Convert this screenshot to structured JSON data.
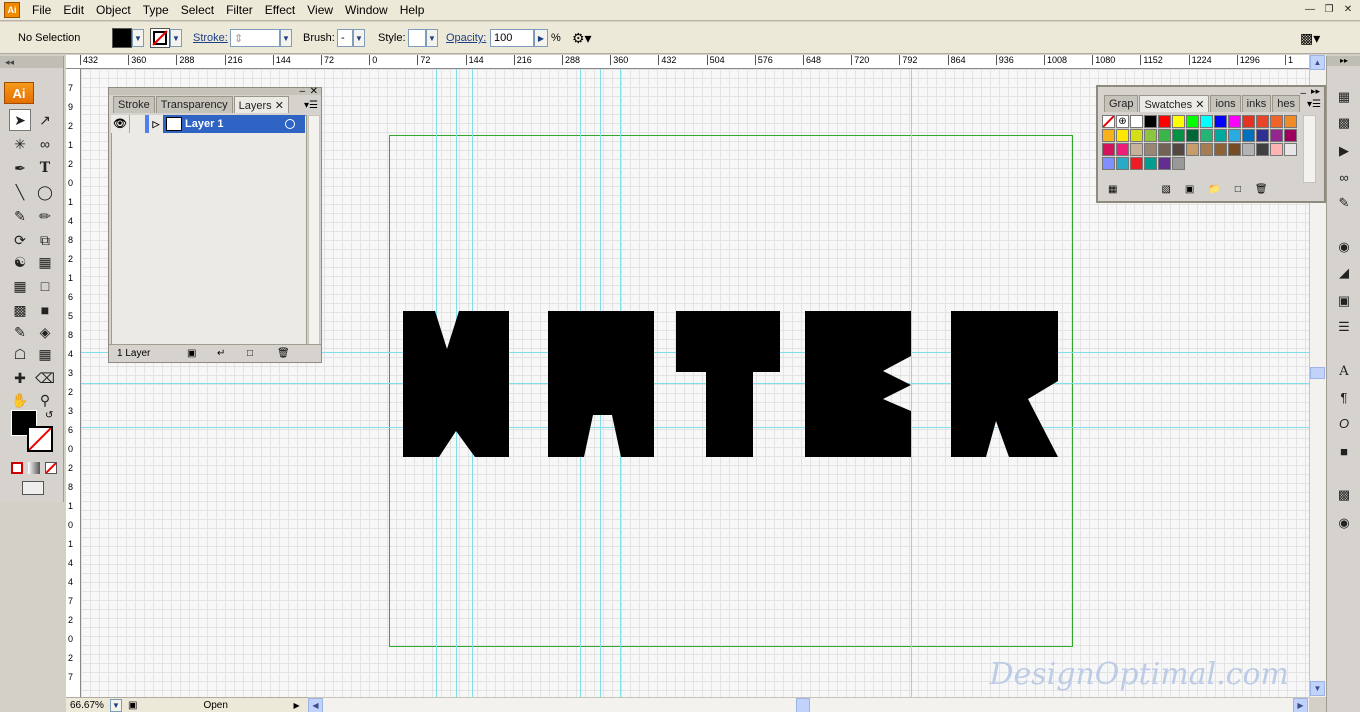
{
  "menubar": {
    "items": [
      "File",
      "Edit",
      "Object",
      "Type",
      "Select",
      "Filter",
      "Effect",
      "View",
      "Window",
      "Help"
    ]
  },
  "controlbar": {
    "selection": "No Selection",
    "stroke_label": "Stroke:",
    "brush_label": "Brush:",
    "brush_value": "-",
    "style_label": "Style:",
    "opacity_label": "Opacity:",
    "opacity_value": "100",
    "percent": "%"
  },
  "tools": {
    "badge": "Ai"
  },
  "ruler": {
    "top": [
      "432",
      "360",
      "288",
      "216",
      "144",
      "72",
      "0",
      "72",
      "144",
      "216",
      "288",
      "360",
      "432",
      "504",
      "576",
      "648",
      "720",
      "792",
      "864",
      "936",
      "1008",
      "1080",
      "1152",
      "1224",
      "1296",
      "1"
    ],
    "left": [
      "7",
      "9",
      "2",
      "1",
      "2",
      "0",
      "1",
      "4",
      "8",
      "2",
      "1",
      "6",
      "5",
      "8",
      "4",
      "3",
      "2",
      "3",
      "6",
      "0",
      "2",
      "8",
      "1",
      "0",
      "1",
      "4",
      "4",
      "7",
      "2",
      "0",
      "2",
      "7"
    ]
  },
  "layers_panel": {
    "tabs": [
      "Stroke",
      "Transparency",
      "Layers"
    ],
    "layer_name": "Layer 1",
    "count": "1 Layer"
  },
  "swatches_panel": {
    "tabs": [
      "Grap",
      "Swatches",
      "ions",
      "inks",
      "hes"
    ],
    "colors": [
      "#ffffff",
      "#000000",
      "#ff0000",
      "#ffff00",
      "#00ff00",
      "#00ffff",
      "#0000ff",
      "#ff00ff",
      "#e63223",
      "#e6452a",
      "#f0642a",
      "#f08c28",
      "#f7b21b",
      "#ffe600",
      "#d4df1a",
      "#8cc63f",
      "#39b54a",
      "#009245",
      "#006837",
      "#22b573",
      "#00a99d",
      "#29abe2",
      "#0071bc",
      "#2e3192",
      "#93278f",
      "#9e005d",
      "#d4145a",
      "#ed1e79",
      "#c7b299",
      "#998675",
      "#736357",
      "#534741",
      "#c69c6d",
      "#a67c52",
      "#8c6239",
      "#754c24",
      "#b3b3b3",
      "#404040",
      "#ffb3b3",
      "#e6e6e6",
      "#808fff",
      "#29abc6",
      "#ed1c24",
      "#009e8f",
      "#662d91",
      "#999999"
    ]
  },
  "statusbar": {
    "zoom": "66.67%",
    "status": "Open"
  },
  "artwork": {
    "word": "WATER"
  },
  "watermark": "DesignOptimal.com"
}
